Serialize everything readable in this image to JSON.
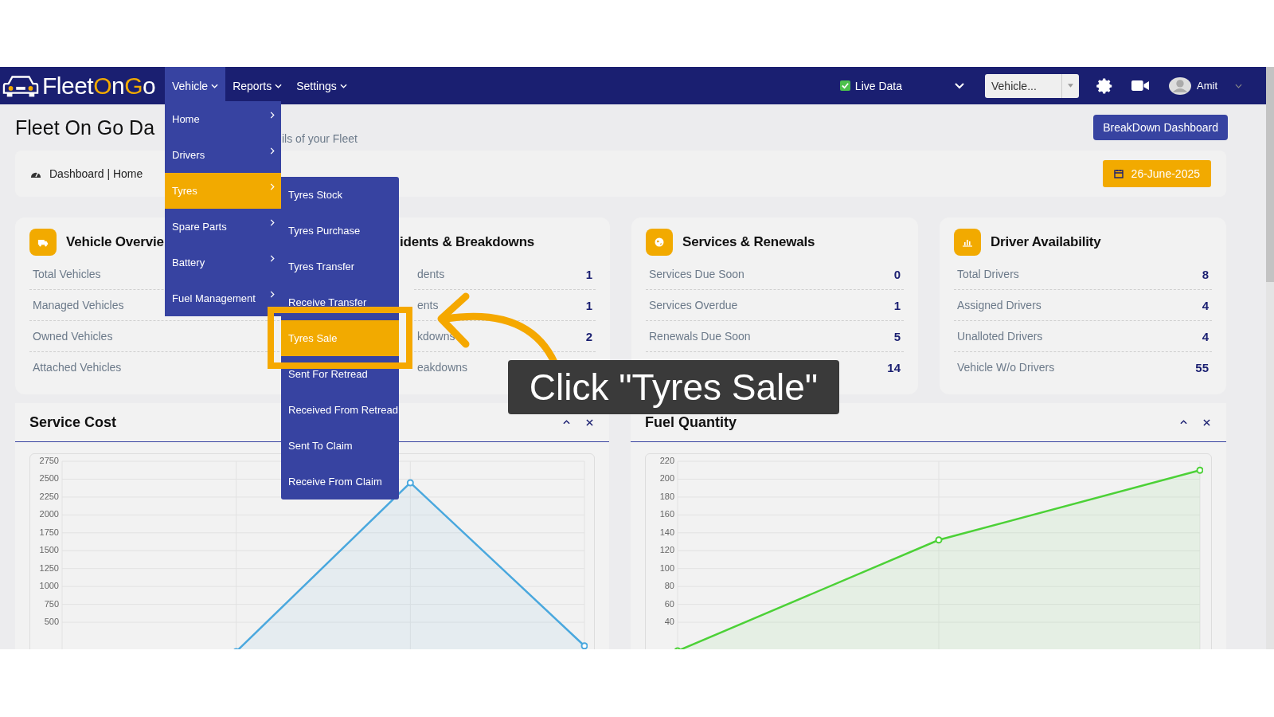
{
  "navbar": {
    "logo": [
      {
        "text": "Fleet",
        "accent": false
      },
      {
        "text": "O",
        "accent": true
      },
      {
        "text": "n",
        "accent": false
      },
      {
        "text": "G",
        "accent": true
      },
      {
        "text": "o",
        "accent": false
      }
    ],
    "menu": [
      {
        "label": "Vehicle",
        "selected": true
      },
      {
        "label": "Reports",
        "selected": false
      },
      {
        "label": "Settings",
        "selected": false
      }
    ],
    "live_data": {
      "label": "Live Data",
      "checked": true
    },
    "vehicle_select": {
      "placeholder": "Vehicle..."
    },
    "user": {
      "name": "Amit"
    }
  },
  "header": {
    "title": "Fleet On Go Da",
    "subtitle": "ils of your Fleet",
    "button": "BreakDown Dashboard"
  },
  "breadcrumb": {
    "text": "Dashboard | Home",
    "date": "26-June-2025"
  },
  "cards": [
    {
      "title": "Vehicle Overvie",
      "rows": [
        {
          "label": "Total Vehicles"
        },
        {
          "label": "Managed Vehicles"
        },
        {
          "label": "Owned Vehicles"
        },
        {
          "label": "Attached Vehicles"
        }
      ]
    },
    {
      "title": "idents & Breakdowns",
      "rows": [
        {
          "label": "dents",
          "value": "1"
        },
        {
          "label": "ents",
          "value": "1"
        },
        {
          "label": "kdowns",
          "value": "2"
        },
        {
          "label": "eakdowns"
        }
      ]
    },
    {
      "title": "Services & Renewals",
      "rows": [
        {
          "label": "Services Due Soon",
          "value": "0"
        },
        {
          "label": "Services Overdue",
          "value": "1"
        },
        {
          "label": "Renewals Due Soon",
          "value": "5"
        },
        {
          "value": "14"
        }
      ]
    },
    {
      "title": "Driver Availability",
      "rows": [
        {
          "label": "Total Drivers",
          "value": "8"
        },
        {
          "label": "Assigned Drivers",
          "value": "4"
        },
        {
          "label": "Unalloted Drivers",
          "value": "4"
        },
        {
          "label": "Vehicle W/o Drivers",
          "value": "55"
        }
      ]
    }
  ],
  "panels": [
    {
      "title": "Service Cost",
      "chart_data": {
        "type": "area",
        "grid": true,
        "categories": [
          null,
          null,
          null,
          null
        ],
        "ylim": [
          0,
          2750
        ],
        "yticks": [
          500,
          750,
          1000,
          1250,
          1500,
          1750,
          2000,
          2250,
          2500,
          2750
        ],
        "series": [
          {
            "color": "#4aa8de",
            "values": [
              null,
              90,
              2450,
              170
            ]
          }
        ]
      }
    },
    {
      "title": "Fuel Quantity",
      "chart_data": {
        "type": "area",
        "grid": true,
        "categories": [
          null,
          null,
          null
        ],
        "ylim": [
          0,
          220
        ],
        "yticks": [
          40,
          60,
          80,
          100,
          120,
          140,
          160,
          180,
          200,
          220
        ],
        "series": [
          {
            "color": "#4cd137",
            "values": [
              8,
              132,
              210
            ]
          }
        ]
      }
    }
  ],
  "vehicle_menu": [
    {
      "label": "Home",
      "selected": false
    },
    {
      "label": "Drivers",
      "selected": false
    },
    {
      "label": "Tyres",
      "selected": true
    },
    {
      "label": "Spare Parts",
      "selected": false
    },
    {
      "label": "Battery",
      "selected": false
    },
    {
      "label": "Fuel Management",
      "selected": false
    }
  ],
  "tyres_submenu": [
    {
      "label": "Tyres Stock",
      "selected": false
    },
    {
      "label": "Tyres Purchase",
      "selected": false
    },
    {
      "label": "Tyres Transfer",
      "selected": false
    },
    {
      "label": "Receive Transfer",
      "selected": false
    },
    {
      "label": "Tyres Sale",
      "selected": true
    },
    {
      "label": "Sent For Retread",
      "selected": false
    },
    {
      "label": "Received From Retread",
      "selected": false
    },
    {
      "label": "Sent To Claim",
      "selected": false
    },
    {
      "label": "Receive From Claim",
      "selected": false
    }
  ],
  "callout": {
    "text": "Click \"Tyres Sale\""
  }
}
